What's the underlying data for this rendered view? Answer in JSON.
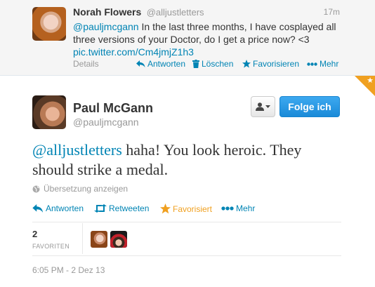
{
  "reply_tweet": {
    "name": "Norah Flowers",
    "handle": "@alljustletters",
    "time": "17m",
    "mention": "@pauljmcgann",
    "text": " In the last three months, I have cosplayed all three versions of your Doctor, do I get a price now? <3",
    "link": "pic.twitter.com/Cm4jmjZ1h3",
    "details_label": "Details",
    "actions": {
      "reply": "Antworten",
      "delete": "Löschen",
      "favorite": "Favorisieren",
      "more": "Mehr"
    }
  },
  "main_tweet": {
    "name": "Paul McGann",
    "handle": "@pauljmcgann",
    "follow_label": "Folge ich",
    "mention": "@alljustletters",
    "text": " haha! You look heroic. They should strike a medal.",
    "translate_label": "Übersetzung anzeigen",
    "actions": {
      "reply": "Antworten",
      "retweet": "Retweeten",
      "favorited": "Favorisiert",
      "more": "Mehr"
    },
    "favorites_count": "2",
    "favorites_label": "FAVORITEN",
    "timestamp": "6:05 PM - 2 Dez 13"
  },
  "colors": {
    "link": "#0084b4",
    "favorite_active": "#f0a020",
    "follow_button": "#2b9ce6"
  },
  "icons": {
    "reply": "reply-arrow-icon",
    "delete": "trash-icon",
    "favorite": "star-icon",
    "more": "ellipsis-icon",
    "retweet": "retweet-icon",
    "translate": "globe-icon",
    "user_menu": "person-icon"
  }
}
